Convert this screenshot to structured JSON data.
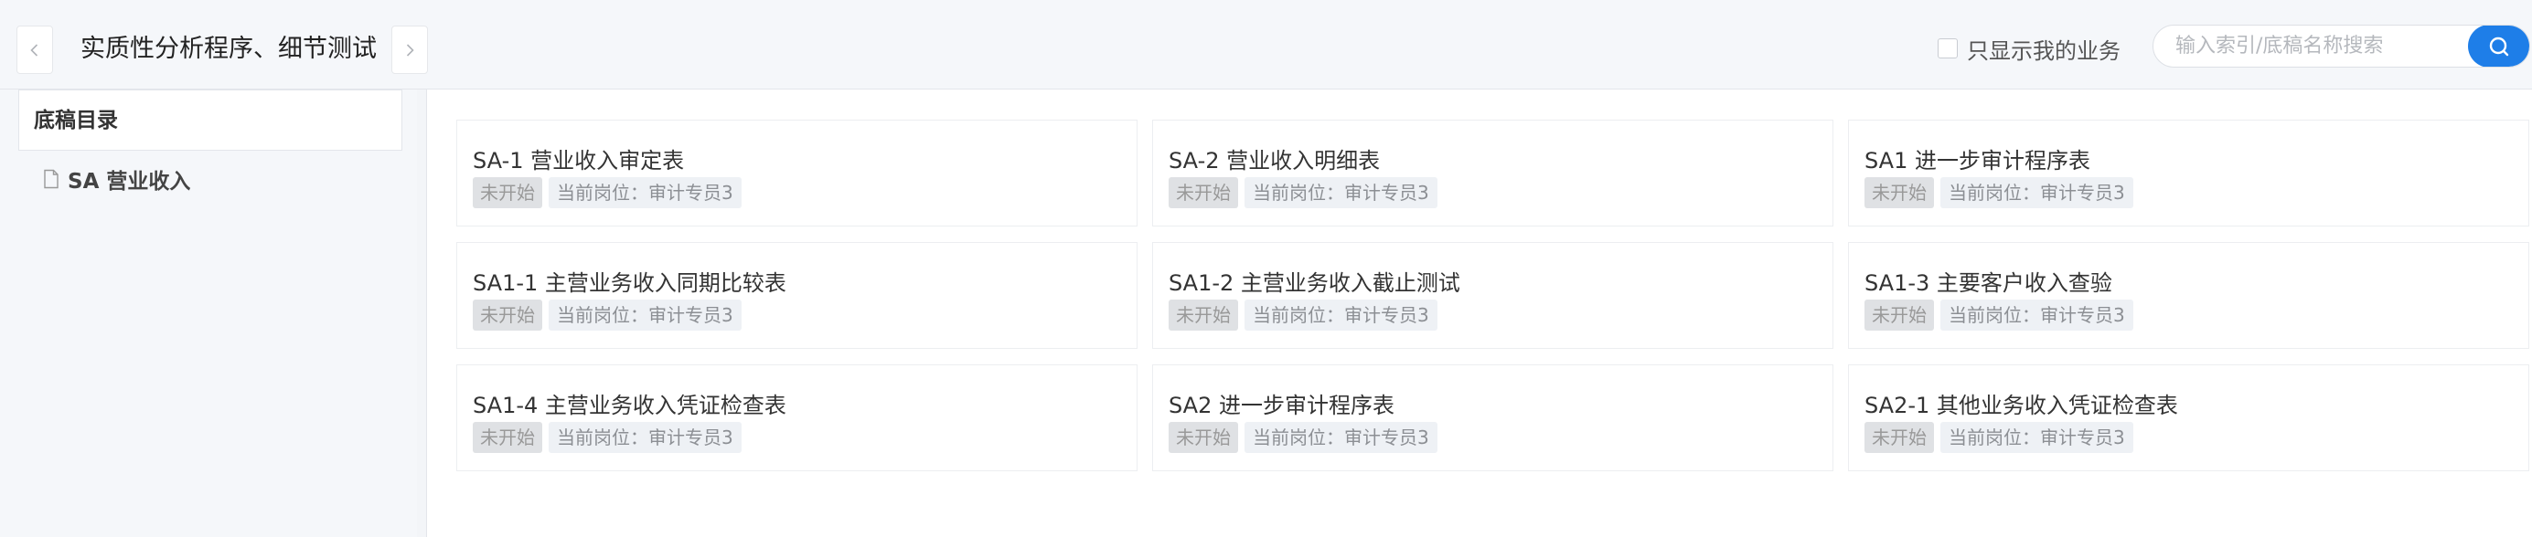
{
  "header": {
    "title": "实质性分析程序、细节测试",
    "only_mine_label": "只显示我的业务",
    "search_placeholder": "输入索引/底稿名称搜索"
  },
  "sidebar": {
    "heading": "底稿目录",
    "items": [
      {
        "label": "SA 营业收入"
      }
    ]
  },
  "cards": [
    {
      "title": "SA-1 营业收入审定表",
      "status": "未开始",
      "role": "当前岗位：审计专员3"
    },
    {
      "title": "SA-2 营业收入明细表",
      "status": "未开始",
      "role": "当前岗位：审计专员3"
    },
    {
      "title": "SA1 进一步审计程序表",
      "status": "未开始",
      "role": "当前岗位：审计专员3"
    },
    {
      "title": "SA1-1 主营业务收入同期比较表",
      "status": "未开始",
      "role": "当前岗位：审计专员3"
    },
    {
      "title": "SA1-2 主营业务收入截止测试",
      "status": "未开始",
      "role": "当前岗位：审计专员3"
    },
    {
      "title": "SA1-3 主要客户收入查验",
      "status": "未开始",
      "role": "当前岗位：审计专员3"
    },
    {
      "title": "SA1-4 主营业务收入凭证检查表",
      "status": "未开始",
      "role": "当前岗位：审计专员3"
    },
    {
      "title": "SA2 进一步审计程序表",
      "status": "未开始",
      "role": "当前岗位：审计专员3"
    },
    {
      "title": "SA2-1 其他业务收入凭证检查表",
      "status": "未开始",
      "role": "当前岗位：审计专员3"
    }
  ],
  "colors": {
    "accent": "#1e7ee8",
    "status_tag_bg": "#dfe1e4",
    "role_tag_bg": "#eef1f5"
  },
  "icons": {
    "prev": "chevron-left-icon",
    "next": "chevron-right-icon",
    "search": "search-icon",
    "file": "file-icon"
  }
}
